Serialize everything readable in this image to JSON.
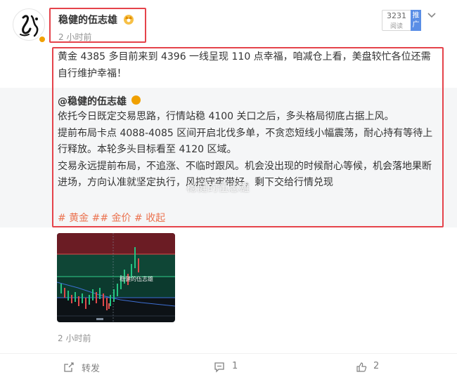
{
  "post": {
    "author": "稳健的伍志雄",
    "time": "2 小时前",
    "read_count": "3231",
    "read_label": "阅读",
    "promote_label": "推广",
    "text": "黄金 4385 多目前来到 4396 一线呈现 110 点幸福，咱减仓上看，美盘较忙各位还需自行维护幸福！"
  },
  "repost": {
    "author": "@稳健的伍志雄",
    "paragraphs": [
      "依托今日既定交易思路，行情站稳 4100 关口之后，多头格局彻底占据上风。",
      "提前布局卡点 4088-4085 区间开启北伐多单，不贪恋短线小幅震荡，耐心持有等待上行释放。本轮多头目标看至 4120 区域。",
      "交易永远提前布局，不追涨、不临时跟风。机会没出现的时候耐心等候，机会落地果断进场，方向认准就坚定执行，风控守牢带好，剩下交给行情兑现"
    ],
    "tags": "# 黄金 ## 金价 #",
    "collapse": "收起"
  },
  "watermark": "稳健的伍志雄",
  "image_watermark": "稳健的伍志雄",
  "time_bottom": "2 小时前",
  "footer": {
    "repost_label": "转发",
    "comment_count": "1",
    "like_count": "2"
  },
  "colors": {
    "highlight_box": "#e5434b",
    "tag": "#eb7350",
    "verified": "#f0a000",
    "promote": "#5a8ee6"
  }
}
